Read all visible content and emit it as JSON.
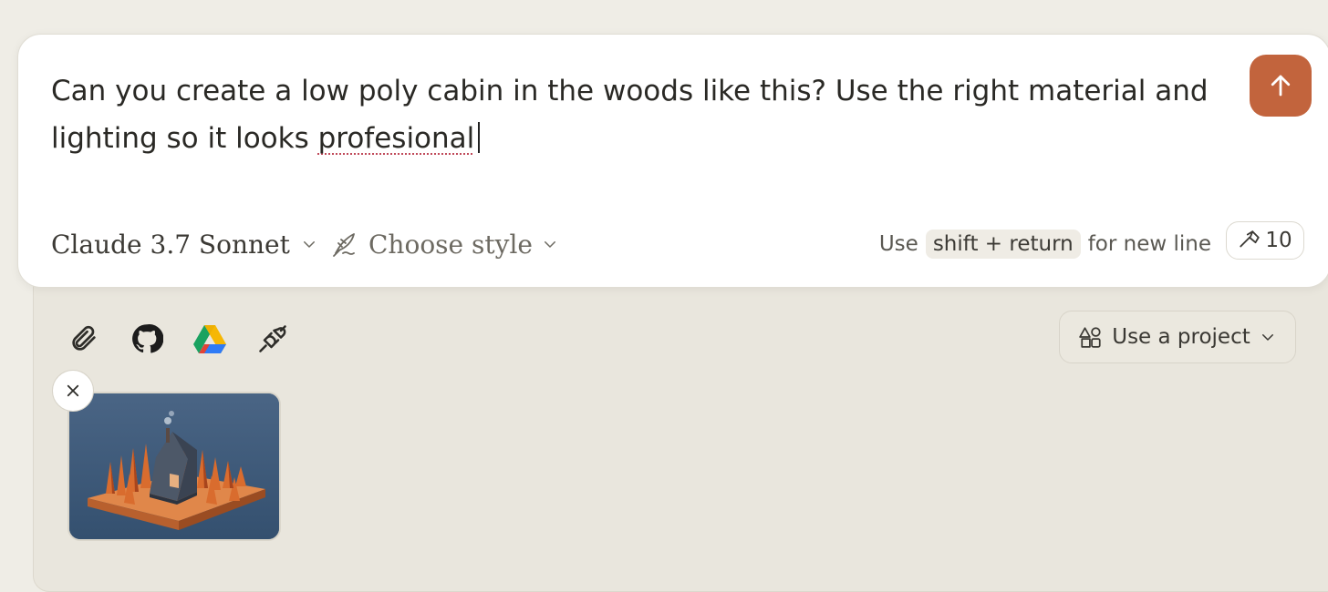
{
  "composer": {
    "prompt_text": "Can you create a low poly cabin in the woods like this? Use the right material and lighting so it looks ",
    "misspelled_word": "profesional",
    "send_icon": "arrow-up-icon",
    "model_label": "Claude 3.7 Sonnet",
    "style_label": "Choose style",
    "hint": {
      "prefix": "Use",
      "shortcut": "shift + return",
      "suffix": "for new line"
    },
    "tools_count": "10"
  },
  "tray": {
    "icons": [
      "paperclip-icon",
      "github-icon",
      "google-drive-icon",
      "plug-icon"
    ],
    "project_label": "Use a project",
    "attachment": {
      "type": "image",
      "thumbnail": "low-poly-cabin-image"
    }
  },
  "colors": {
    "accent": "#c2643d",
    "background": "#efede6",
    "tray": "#e9e6dd",
    "composer": "#ffffff"
  }
}
